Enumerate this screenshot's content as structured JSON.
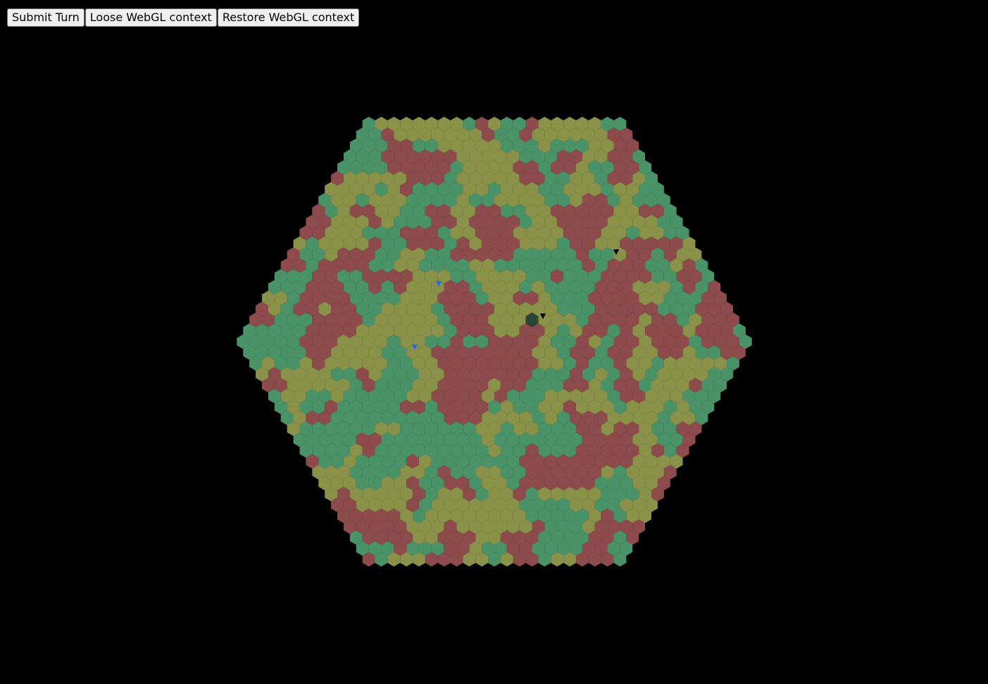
{
  "toolbar": {
    "submit_turn_label": "Submit Turn",
    "lose_context_label": "Loose WebGL context",
    "restore_context_label": "Restore WebGL context"
  },
  "board": {
    "shape": "hexagonal hex-tile map",
    "rings": 20,
    "terrain_colors": {
      "red": "#8e4b4b",
      "green": "#4a9268",
      "olive": "#8a924a"
    },
    "highlight_tile_color": "#2a4535",
    "background": "#000000",
    "units": [
      {
        "name": "unit-blue-1",
        "color": "#1a6cff"
      },
      {
        "name": "unit-blue-2",
        "color": "#1a6cff"
      },
      {
        "name": "unit-black-1",
        "color": "#000000"
      },
      {
        "name": "unit-black-2",
        "color": "#000000"
      }
    ]
  }
}
